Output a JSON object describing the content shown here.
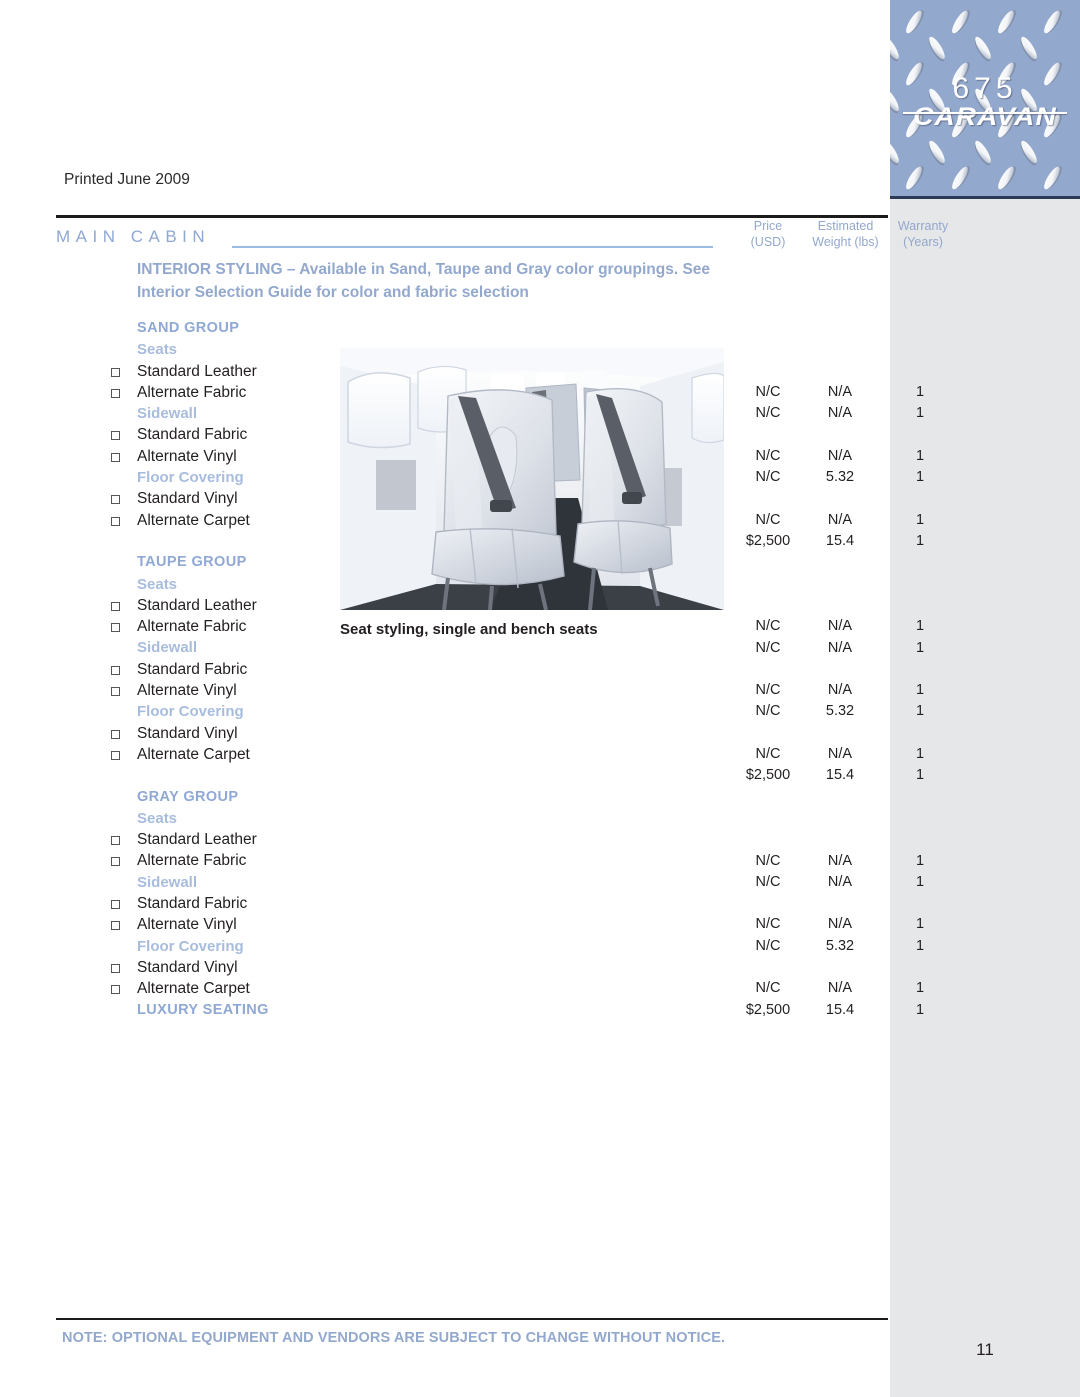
{
  "document": {
    "printed": "Printed June 2009",
    "page_number": "11",
    "footer_note": "NOTE:  OPTIONAL EQUIPMENT AND VENDORS ARE SUBJECT TO CHANGE WITHOUT NOTICE."
  },
  "banner": {
    "model_number": "675",
    "model_name": "CARAVAN",
    "background_color": "#93a8cd",
    "texture": "diamond-plate"
  },
  "section": {
    "title": "MAIN CABIN",
    "intro": "INTERIOR STYLING – Available in Sand, Taupe and Gray color groupings. See Interior Selection Guide for color and fabric selection"
  },
  "columns": {
    "price": "Price\n(USD)",
    "price_line1": "Price",
    "price_line2": "(USD)",
    "weight_line1": "Estimated",
    "weight_line2": "Weight (lbs)",
    "warranty_line1": "Warranty",
    "warranty_line2": "(Years)"
  },
  "photo": {
    "caption": "Seat styling, single and bench seats",
    "alt": "Aircraft main cabin interior with leather single and bench seats"
  },
  "colors": {
    "accent_blue": "#8fa8d4",
    "light_blue": "#a8bcdd",
    "rule_blue": "#9dbbe0",
    "gray_band": "#e6e7e8",
    "text": "#231f20"
  },
  "rows": [
    {
      "type": "group",
      "label": "SAND GROUP"
    },
    {
      "type": "sub",
      "label": "Seats"
    },
    {
      "type": "option",
      "label": "Standard Leather"
    },
    {
      "type": "option",
      "label": "Alternate Fabric",
      "price": "N/C",
      "weight": "N/A",
      "warranty": "1"
    },
    {
      "type": "sub",
      "label": "Sidewall",
      "price": "N/C",
      "weight": "N/A",
      "warranty": "1"
    },
    {
      "type": "option",
      "label": "Standard Fabric"
    },
    {
      "type": "option",
      "label": "Alternate Vinyl",
      "price": "N/C",
      "weight": "N/A",
      "warranty": "1"
    },
    {
      "type": "sub",
      "label": "Floor Covering",
      "price": "N/C",
      "weight": "5.32",
      "warranty": "1"
    },
    {
      "type": "option",
      "label": "Standard Vinyl"
    },
    {
      "type": "option",
      "label": "Alternate Carpet",
      "price": "N/C",
      "weight": "N/A",
      "warranty": "1"
    },
    {
      "type": "spacer",
      "label": "",
      "price": "$2,500",
      "weight": "15.4",
      "warranty": "1"
    },
    {
      "type": "group",
      "label": "TAUPE GROUP"
    },
    {
      "type": "sub",
      "label": "Seats"
    },
    {
      "type": "option",
      "label": "Standard Leather"
    },
    {
      "type": "option",
      "label": "Alternate Fabric",
      "price": "N/C",
      "weight": "N/A",
      "warranty": "1"
    },
    {
      "type": "sub",
      "label": "Sidewall",
      "price": "N/C",
      "weight": "N/A",
      "warranty": "1"
    },
    {
      "type": "option",
      "label": "Standard Fabric"
    },
    {
      "type": "option",
      "label": "Alternate Vinyl",
      "price": "N/C",
      "weight": "N/A",
      "warranty": "1"
    },
    {
      "type": "sub",
      "label": "Floor Covering",
      "price": "N/C",
      "weight": "5.32",
      "warranty": "1"
    },
    {
      "type": "option",
      "label": "Standard Vinyl"
    },
    {
      "type": "option",
      "label": "Alternate Carpet",
      "price": "N/C",
      "weight": "N/A",
      "warranty": "1"
    },
    {
      "type": "spacer",
      "label": "",
      "price": "$2,500",
      "weight": "15.4",
      "warranty": "1"
    },
    {
      "type": "group",
      "label": "GRAY GROUP"
    },
    {
      "type": "sub",
      "label": "Seats"
    },
    {
      "type": "option",
      "label": "Standard Leather"
    },
    {
      "type": "option",
      "label": "Alternate Fabric",
      "price": "N/C",
      "weight": "N/A",
      "warranty": "1"
    },
    {
      "type": "sub",
      "label": "Sidewall",
      "price": "N/C",
      "weight": "N/A",
      "warranty": "1"
    },
    {
      "type": "option",
      "label": "Standard Fabric"
    },
    {
      "type": "option",
      "label": "Alternate Vinyl",
      "price": "N/C",
      "weight": "N/A",
      "warranty": "1"
    },
    {
      "type": "sub",
      "label": "Floor Covering",
      "price": "N/C",
      "weight": "5.32",
      "warranty": "1"
    },
    {
      "type": "option",
      "label": "Standard Vinyl"
    },
    {
      "type": "option",
      "label": "Alternate Carpet",
      "price": "N/C",
      "weight": "N/A",
      "warranty": "1"
    },
    {
      "type": "group",
      "label": "LUXURY SEATING",
      "price": "$2,500",
      "weight": "15.4",
      "warranty": "1"
    }
  ]
}
